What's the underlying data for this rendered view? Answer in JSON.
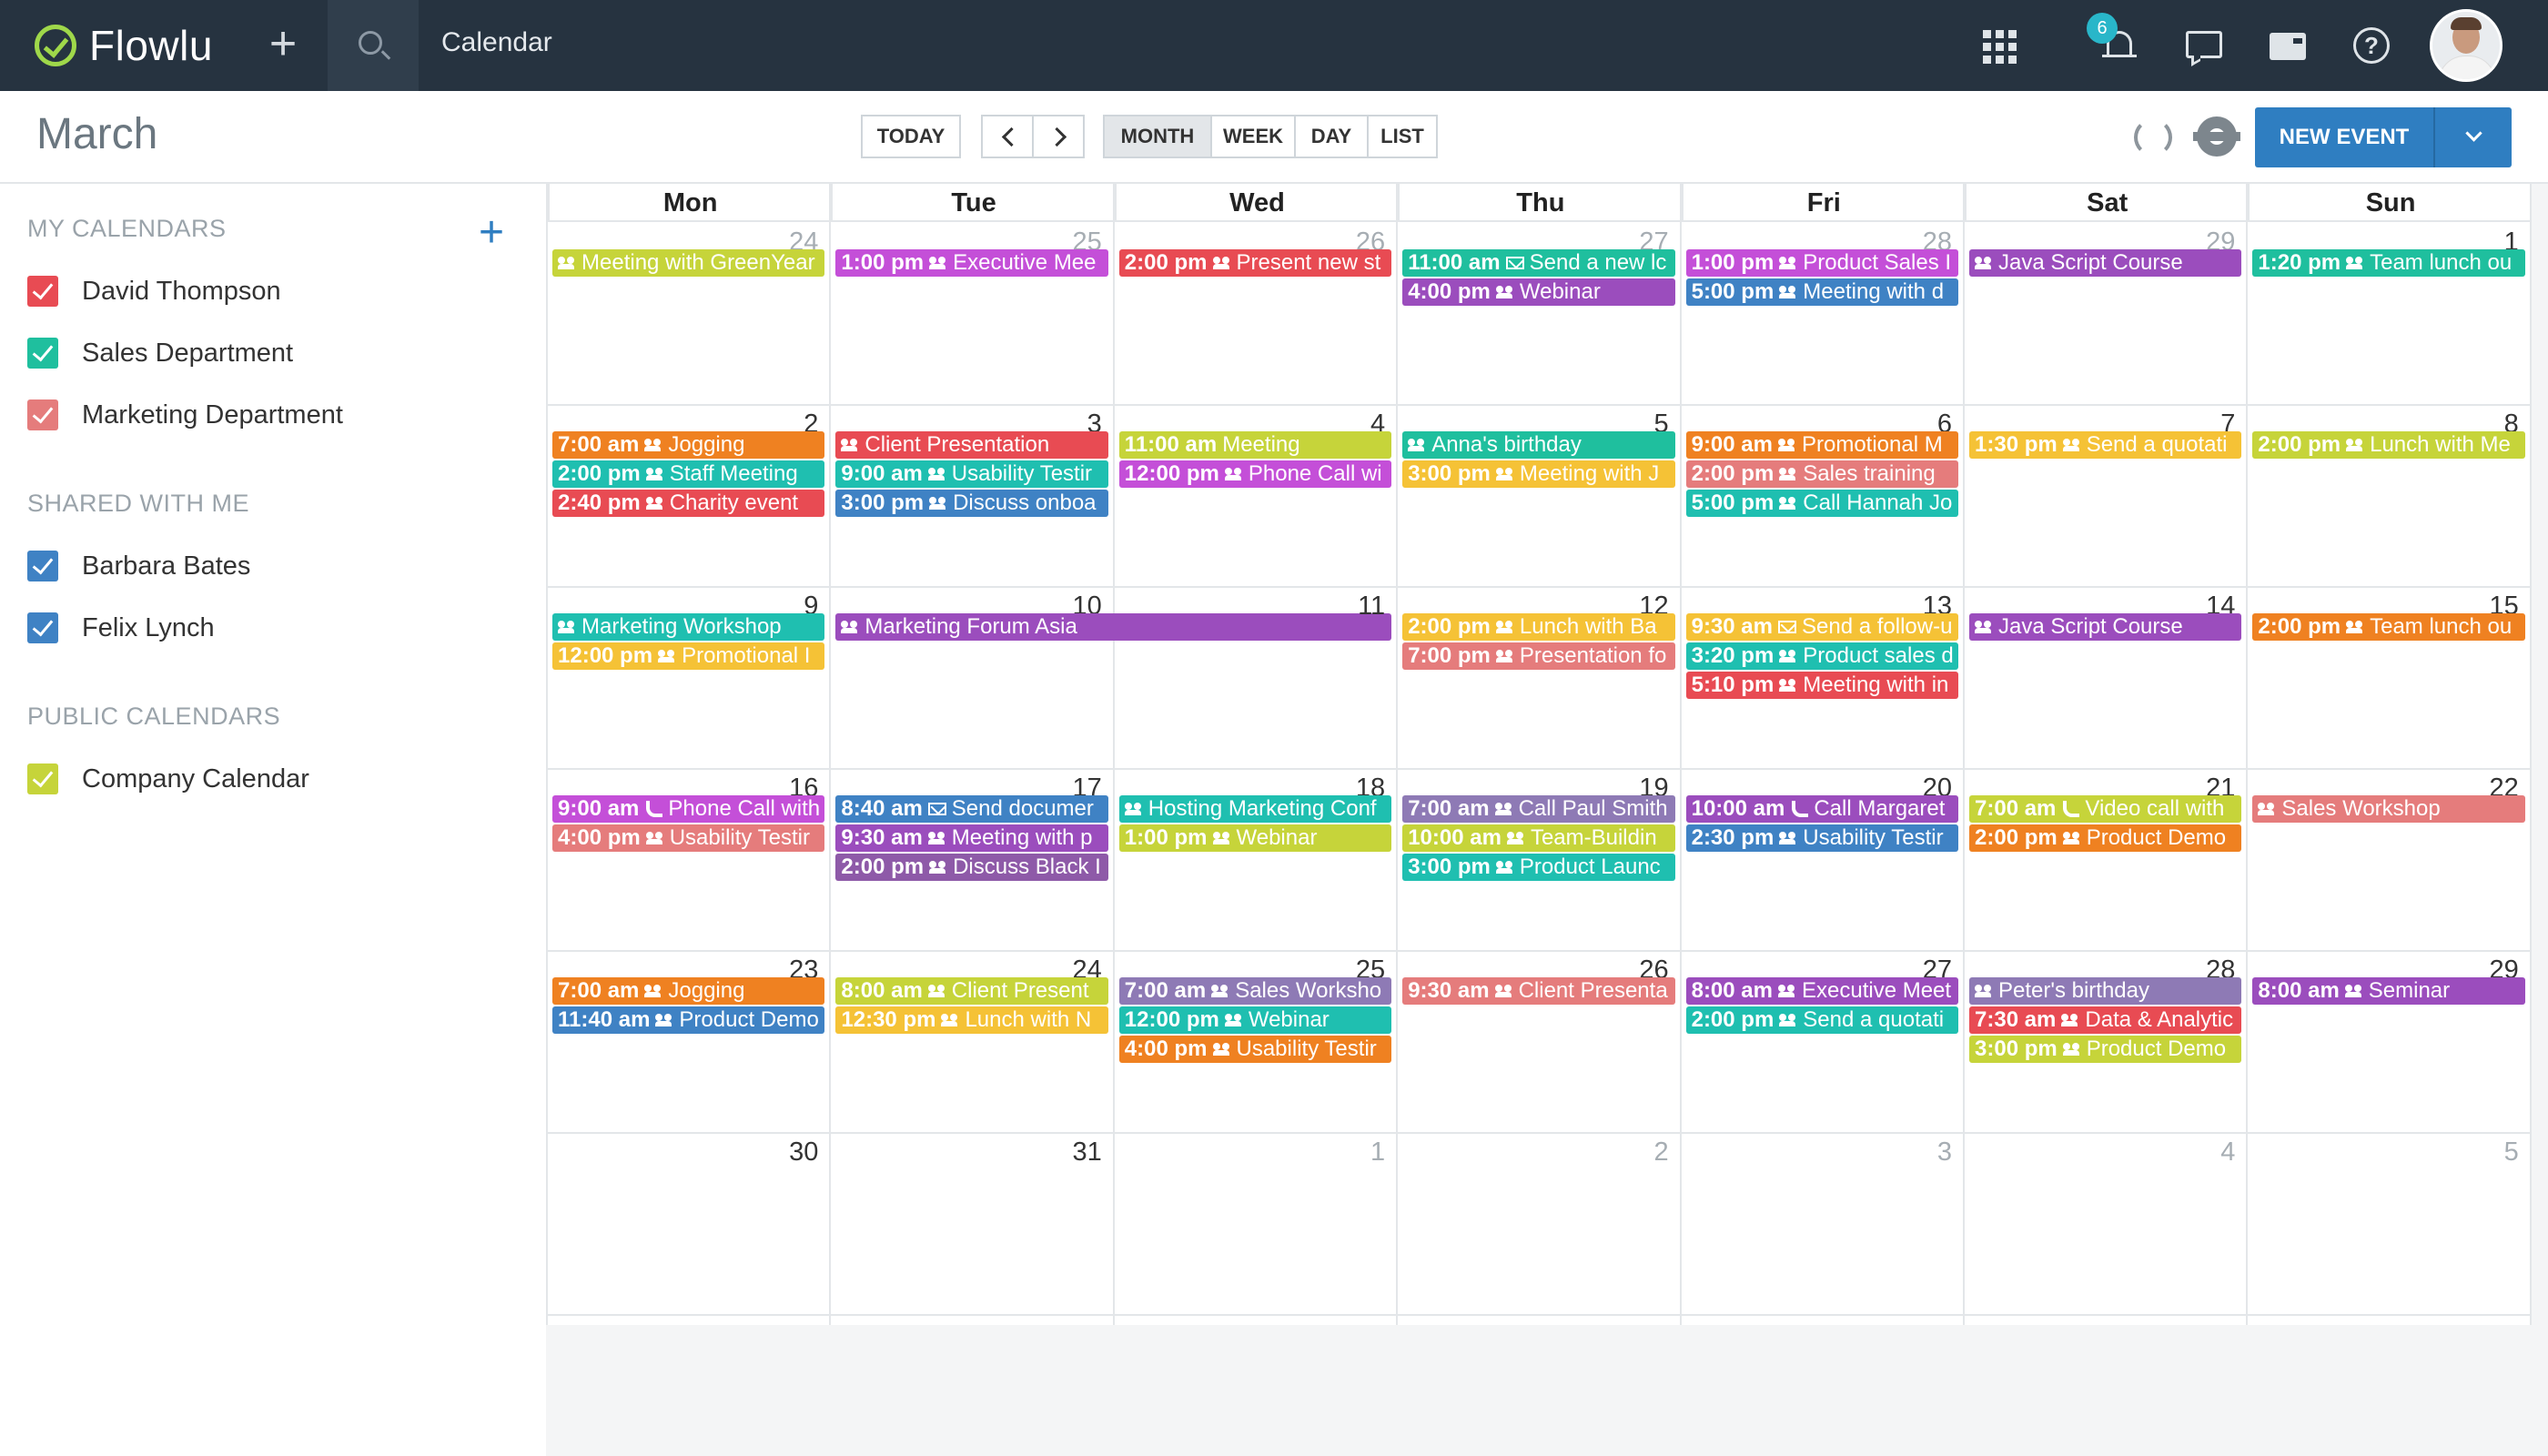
{
  "app": {
    "name": "Flowlu",
    "section_title": "Calendar",
    "notifications_count": "6"
  },
  "toolbar": {
    "month_title": "March",
    "today_label": "TODAY",
    "view_month": "MONTH",
    "view_week": "WEEK",
    "view_day": "DAY",
    "view_list": "LIST",
    "active_view": "MONTH",
    "new_event_label": "NEW EVENT"
  },
  "sidebar": {
    "my_calendars_title": "MY CALENDARS",
    "my_calendars": [
      {
        "label": "David Thompson",
        "color": "#e84b53"
      },
      {
        "label": "Sales Department",
        "color": "#1fbf9e"
      },
      {
        "label": "Marketing Department",
        "color": "#e57c7c"
      }
    ],
    "shared_title": "SHARED WITH ME",
    "shared": [
      {
        "label": "Barbara Bates",
        "color": "#3f82c4"
      },
      {
        "label": "Felix Lynch",
        "color": "#3f82c4"
      }
    ],
    "public_title": "PUBLIC CALENDARS",
    "public": [
      {
        "label": "Company Calendar",
        "color": "#c6d43a"
      }
    ]
  },
  "calendar": {
    "weekdays": [
      "Mon",
      "Tue",
      "Wed",
      "Thu",
      "Fri",
      "Sat",
      "Sun"
    ],
    "weeks": [
      [
        {
          "day": "24",
          "out": true,
          "events": [
            {
              "time": "",
              "icon": "group",
              "title": "Meeting with GreenYear",
              "color": "#c6d43a"
            }
          ]
        },
        {
          "day": "25",
          "out": true,
          "events": [
            {
              "time": "1:00 pm",
              "icon": "group",
              "title": "Executive Mee",
              "color": "#c44fd8"
            }
          ]
        },
        {
          "day": "26",
          "out": true,
          "events": [
            {
              "time": "2:00 pm",
              "icon": "group",
              "title": "Present new st",
              "color": "#e84b53"
            }
          ]
        },
        {
          "day": "27",
          "out": true,
          "events": [
            {
              "time": "11:00 am",
              "icon": "mail",
              "title": "Send a new lc",
              "color": "#1fbf9e"
            },
            {
              "time": "4:00 pm",
              "icon": "group",
              "title": "Webinar",
              "color": "#9b4dbd"
            }
          ]
        },
        {
          "day": "28",
          "out": true,
          "events": [
            {
              "time": "1:00 pm",
              "icon": "group",
              "title": "Product Sales I",
              "color": "#c44fd8"
            },
            {
              "time": "5:00 pm",
              "icon": "group",
              "title": "Meeting with d",
              "color": "#3f82c4"
            }
          ]
        },
        {
          "day": "29",
          "out": true,
          "events": [
            {
              "time": "",
              "icon": "group",
              "title": "Java Script Course",
              "color": "#9b4dbd"
            }
          ]
        },
        {
          "day": "1",
          "out": false,
          "events": [
            {
              "time": "1:20 pm",
              "icon": "group",
              "title": "Team lunch ou",
              "color": "#1fbf9e"
            }
          ]
        }
      ],
      [
        {
          "day": "2",
          "out": false,
          "events": [
            {
              "time": "7:00 am",
              "icon": "group",
              "title": "Jogging",
              "color": "#ef8121"
            },
            {
              "time": "2:00 pm",
              "icon": "group",
              "title": "Staff Meeting",
              "color": "#1fbfb0"
            },
            {
              "time": "2:40 pm",
              "icon": "group",
              "title": "Charity event",
              "color": "#e84b53"
            }
          ]
        },
        {
          "day": "3",
          "out": false,
          "events": [
            {
              "time": "",
              "icon": "group",
              "title": "Client Presentation",
              "color": "#e84b53"
            },
            {
              "time": "9:00 am",
              "icon": "group",
              "title": "Usability Testir",
              "color": "#1fbfb0"
            },
            {
              "time": "3:00 pm",
              "icon": "group",
              "title": "Discuss onboa",
              "color": "#3f82c4"
            }
          ]
        },
        {
          "day": "4",
          "out": false,
          "events": [
            {
              "time": "11:00 am",
              "icon": "",
              "title": "Meeting",
              "color": "#c6d43a"
            },
            {
              "time": "12:00 pm",
              "icon": "group",
              "title": "Phone Call wi",
              "color": "#c44fd8"
            }
          ]
        },
        {
          "day": "5",
          "out": false,
          "events": [
            {
              "time": "",
              "icon": "group",
              "title": "Anna's birthday",
              "color": "#1fbf9e"
            },
            {
              "time": "3:00 pm",
              "icon": "group",
              "title": "Meeting with J",
              "color": "#f5c236"
            }
          ]
        },
        {
          "day": "6",
          "out": false,
          "events": [
            {
              "time": "9:00 am",
              "icon": "group",
              "title": "Promotional M",
              "color": "#ef8121"
            },
            {
              "time": "2:00 pm",
              "icon": "group",
              "title": "Sales training",
              "color": "#e57c7c"
            },
            {
              "time": "5:00 pm",
              "icon": "group",
              "title": "Call Hannah Jo",
              "color": "#1fbfb0"
            }
          ]
        },
        {
          "day": "7",
          "out": false,
          "events": [
            {
              "time": "1:30 pm",
              "icon": "group",
              "title": "Send a quotati",
              "color": "#f5c236"
            }
          ]
        },
        {
          "day": "8",
          "out": false,
          "events": [
            {
              "time": "2:00 pm",
              "icon": "group",
              "title": "Lunch with Me",
              "color": "#c6d43a"
            }
          ]
        }
      ],
      [
        {
          "day": "9",
          "out": false,
          "events": [
            {
              "time": "",
              "icon": "group",
              "title": "Marketing Workshop",
              "color": "#1fbfb0"
            },
            {
              "time": "12:00 pm",
              "icon": "group",
              "title": "Promotional I",
              "color": "#f5c236"
            }
          ]
        },
        {
          "day": "10",
          "out": false,
          "events": [
            {
              "time": "",
              "icon": "group",
              "title": "Marketing Forum Asia",
              "color": "#9b4dbd",
              "span": 2
            }
          ]
        },
        {
          "day": "11",
          "out": false,
          "events": []
        },
        {
          "day": "12",
          "out": false,
          "events": [
            {
              "time": "2:00 pm",
              "icon": "group",
              "title": "Lunch with Ba",
              "color": "#f5c236"
            },
            {
              "time": "7:00 pm",
              "icon": "group",
              "title": "Presentation fo",
              "color": "#e57c7c"
            }
          ]
        },
        {
          "day": "13",
          "out": false,
          "events": [
            {
              "time": "9:30 am",
              "icon": "mail",
              "title": "Send a follow-u",
              "color": "#f5c236"
            },
            {
              "time": "3:20 pm",
              "icon": "group",
              "title": "Product sales d",
              "color": "#1fbfb0"
            },
            {
              "time": "5:10 pm",
              "icon": "group",
              "title": "Meeting with in",
              "color": "#e84b53"
            }
          ]
        },
        {
          "day": "14",
          "out": false,
          "events": [
            {
              "time": "",
              "icon": "group",
              "title": "Java Script Course",
              "color": "#9b4dbd"
            }
          ]
        },
        {
          "day": "15",
          "out": false,
          "events": [
            {
              "time": "2:00 pm",
              "icon": "group",
              "title": "Team lunch ou",
              "color": "#ef8121"
            }
          ]
        }
      ],
      [
        {
          "day": "16",
          "out": false,
          "events": [
            {
              "time": "9:00 am",
              "icon": "phone",
              "title": "Phone Call with",
              "color": "#c44fd8"
            },
            {
              "time": "4:00 pm",
              "icon": "group",
              "title": "Usability Testir",
              "color": "#e57c7c"
            }
          ]
        },
        {
          "day": "17",
          "out": false,
          "events": [
            {
              "time": "8:40 am",
              "icon": "mail",
              "title": "Send documer",
              "color": "#3f82c4"
            },
            {
              "time": "9:30 am",
              "icon": "group",
              "title": "Meeting with p",
              "color": "#9b4dbd"
            },
            {
              "time": "2:00 pm",
              "icon": "group",
              "title": "Discuss Black I",
              "color": "#8e5aa8"
            }
          ]
        },
        {
          "day": "18",
          "out": false,
          "events": [
            {
              "time": "",
              "icon": "group",
              "title": "Hosting Marketing Conf",
              "color": "#1fbfb0"
            },
            {
              "time": "1:00 pm",
              "icon": "group",
              "title": "Webinar",
              "color": "#c6d43a"
            }
          ]
        },
        {
          "day": "19",
          "out": false,
          "events": [
            {
              "time": "7:00 am",
              "icon": "group",
              "title": "Call Paul Smith",
              "color": "#8e7ab5"
            },
            {
              "time": "10:00 am",
              "icon": "group",
              "title": "Team-Buildin",
              "color": "#c6d43a"
            },
            {
              "time": "3:00 pm",
              "icon": "group",
              "title": "Product Launc",
              "color": "#1fbfb0"
            }
          ]
        },
        {
          "day": "20",
          "out": false,
          "events": [
            {
              "time": "10:00 am",
              "icon": "phone",
              "title": "Call Margaret",
              "color": "#9b4dbd"
            },
            {
              "time": "2:30 pm",
              "icon": "group",
              "title": "Usability Testir",
              "color": "#3f82c4"
            }
          ]
        },
        {
          "day": "21",
          "out": false,
          "events": [
            {
              "time": "7:00 am",
              "icon": "phone",
              "title": "Video call with",
              "color": "#c6d43a"
            },
            {
              "time": "2:00 pm",
              "icon": "group",
              "title": "Product Demo",
              "color": "#ef8121"
            }
          ]
        },
        {
          "day": "22",
          "out": false,
          "events": [
            {
              "time": "",
              "icon": "group",
              "title": "Sales Workshop",
              "color": "#e57c7c"
            }
          ]
        }
      ],
      [
        {
          "day": "23",
          "out": false,
          "events": [
            {
              "time": "7:00 am",
              "icon": "group",
              "title": "Jogging",
              "color": "#ef8121"
            },
            {
              "time": "11:40 am",
              "icon": "group",
              "title": "Product Demo",
              "color": "#3f82c4"
            }
          ]
        },
        {
          "day": "24",
          "out": false,
          "events": [
            {
              "time": "8:00 am",
              "icon": "group",
              "title": "Client Present",
              "color": "#c6d43a"
            },
            {
              "time": "12:30 pm",
              "icon": "group",
              "title": "Lunch with N",
              "color": "#f5c236"
            }
          ]
        },
        {
          "day": "25",
          "out": false,
          "events": [
            {
              "time": "7:00 am",
              "icon": "group",
              "title": "Sales Worksho",
              "color": "#8e7ab5"
            },
            {
              "time": "12:00 pm",
              "icon": "group",
              "title": "Webinar",
              "color": "#1fbfb0"
            },
            {
              "time": "4:00 pm",
              "icon": "group",
              "title": "Usability Testir",
              "color": "#ef8121"
            }
          ]
        },
        {
          "day": "26",
          "out": false,
          "events": [
            {
              "time": "9:30 am",
              "icon": "group",
              "title": "Client Presenta",
              "color": "#e57c7c"
            }
          ]
        },
        {
          "day": "27",
          "out": false,
          "events": [
            {
              "time": "8:00 am",
              "icon": "group",
              "title": "Executive Meet",
              "color": "#9b4dbd"
            },
            {
              "time": "2:00 pm",
              "icon": "group",
              "title": "Send a quotati",
              "color": "#1fbfb0"
            }
          ]
        },
        {
          "day": "28",
          "out": false,
          "events": [
            {
              "time": "",
              "icon": "group",
              "title": "Peter's birthday",
              "color": "#8e7ab5"
            },
            {
              "time": "7:30 am",
              "icon": "group",
              "title": "Data & Analytic",
              "color": "#e84b53"
            },
            {
              "time": "3:00 pm",
              "icon": "group",
              "title": "Product Demo",
              "color": "#c6d43a"
            }
          ]
        },
        {
          "day": "29",
          "out": false,
          "events": [
            {
              "time": "8:00 am",
              "icon": "group",
              "title": "Seminar",
              "color": "#9b4dbd"
            }
          ]
        }
      ],
      [
        {
          "day": "30",
          "out": false,
          "events": []
        },
        {
          "day": "31",
          "out": false,
          "events": []
        },
        {
          "day": "1",
          "out": true,
          "events": []
        },
        {
          "day": "2",
          "out": true,
          "events": []
        },
        {
          "day": "3",
          "out": true,
          "events": []
        },
        {
          "day": "4",
          "out": true,
          "events": []
        },
        {
          "day": "5",
          "out": true,
          "events": []
        }
      ]
    ]
  }
}
